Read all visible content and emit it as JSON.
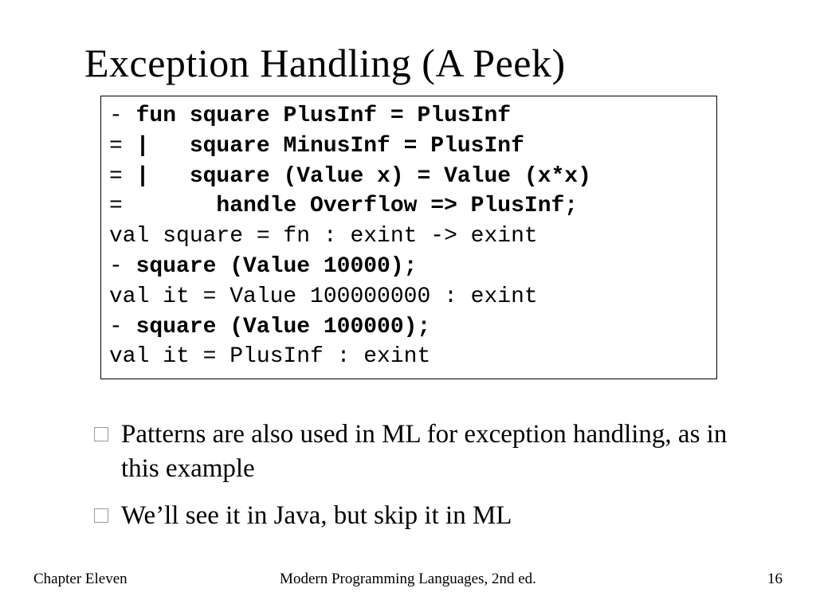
{
  "title": "Exception Handling (A Peek)",
  "code": {
    "l1p": "- ",
    "l1b": "fun square PlusInf = PlusInf",
    "l2p": "= ",
    "l2b": "|   square MinusInf = PlusInf",
    "l3p": "= ",
    "l3b": "|   square (Value x) = Value (x*x)",
    "l4p": "= ",
    "l4b": "      handle Overflow => PlusInf;",
    "l5": "val square = fn : exint -> exint",
    "l6p": "- ",
    "l6b": "square (Value 10000);",
    "l7": "val it = Value 100000000 : exint",
    "l8p": "- ",
    "l8b": "square (Value 100000);",
    "l9": "val it = PlusInf : exint"
  },
  "bullets": [
    "Patterns are also used in ML for exception handling, as in this example",
    "We’ll see it in Java, but skip it in ML"
  ],
  "footer": {
    "left": "Chapter Eleven",
    "center": "Modern Programming Languages, 2nd ed.",
    "right": "16"
  }
}
